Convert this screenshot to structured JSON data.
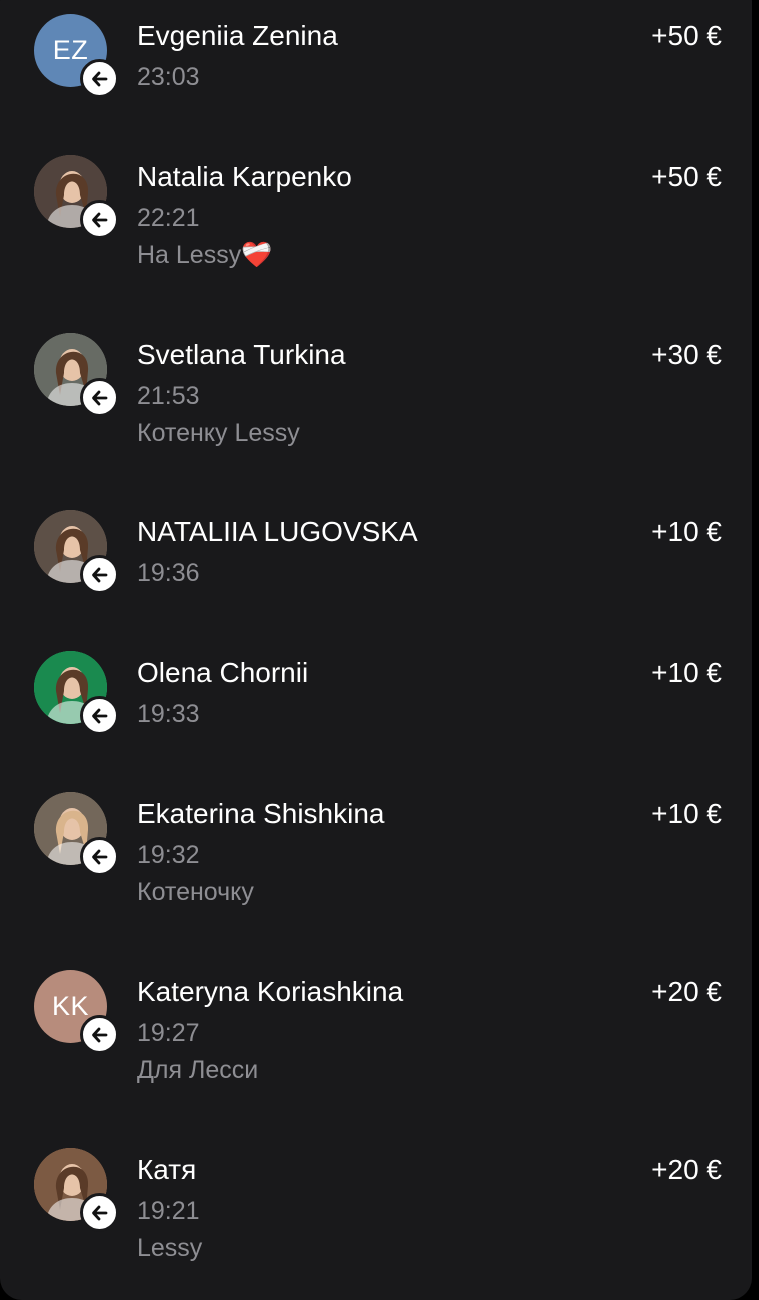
{
  "donations": [
    {
      "name": "Evgeniia Zenina",
      "time": "23:03",
      "amount": "+50 €",
      "comment": "",
      "avatar": {
        "type": "initials",
        "initials": "EZ",
        "color": "#5f87b6"
      }
    },
    {
      "name": "Natalia Karpenko",
      "time": "22:21",
      "amount": "+50 €",
      "comment": "На Lessy❤️‍🩹",
      "avatar": {
        "type": "photo",
        "color": "#6d5a52"
      }
    },
    {
      "name": "Svetlana Turkina",
      "time": "21:53",
      "amount": "+30 €",
      "comment": "Котенку Lessy",
      "avatar": {
        "type": "photo",
        "color": "#8a8f86"
      }
    },
    {
      "name": "NATALIIA LUGOVSKA",
      "time": "19:36",
      "amount": "+10 €",
      "comment": "",
      "avatar": {
        "type": "photo",
        "color": "#7c6b5f"
      }
    },
    {
      "name": "Olena Chornii",
      "time": "19:33",
      "amount": "+10 €",
      "comment": "",
      "avatar": {
        "type": "photo",
        "color": "#23b96a"
      }
    },
    {
      "name": "Ekaterina Shishkina",
      "time": "19:32",
      "amount": "+10 €",
      "comment": "Котеночку",
      "avatar": {
        "type": "photo",
        "color": "#9a8a78"
      }
    },
    {
      "name": "Kateryna Koriashkina",
      "time": "19:27",
      "amount": "+20 €",
      "comment": "Для Лесси",
      "avatar": {
        "type": "initials",
        "initials": "KK",
        "color": "#b78c7c"
      }
    },
    {
      "name": "Катя",
      "time": "19:21",
      "amount": "+20 €",
      "comment": "Lessy",
      "avatar": {
        "type": "photo",
        "color": "#a6785a"
      }
    }
  ],
  "icons": {
    "incoming_badge": "arrow-left-icon"
  },
  "colors": {
    "background": "#19191b",
    "secondary_text": "#8e8e93",
    "primary_text": "#ffffff"
  }
}
